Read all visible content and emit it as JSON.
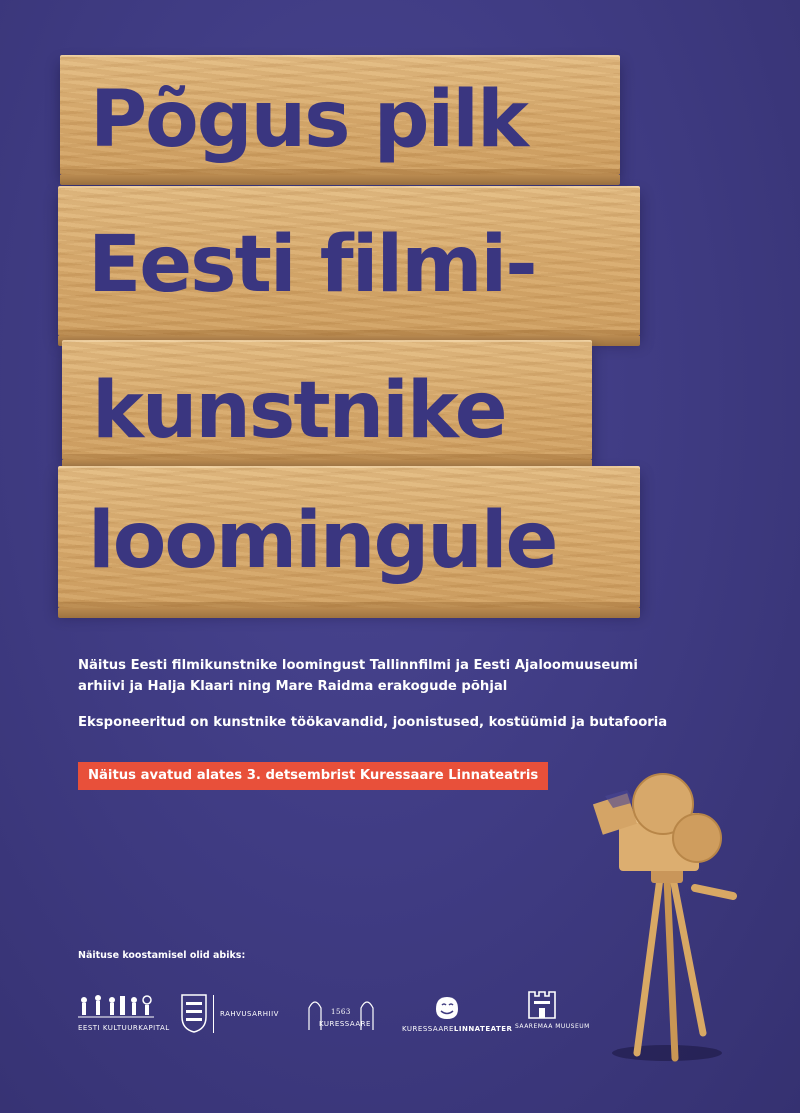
{
  "poster": {
    "title_lines": [
      "Põgus pilk",
      "Eesti filmi-",
      "kunstnike",
      "loomingule"
    ],
    "description_1_line_1": "Näitus Eesti filmikunstnike loomingust Tallinnfilmi ja Eesti Ajaloomuuseumi",
    "description_1_line_2": "arhiivi ja Halja Klaari ning Mare Raidma erakogude põhjal",
    "description_2": "Eksponeeritud on kunstnike töökavandid, joonistused, kostüümid ja butafooria",
    "opening_notice": "Näitus avatud alates 3. detsembrist Kuressaare Linnateatris",
    "helpers_heading": "Näituse koostamisel olid abiks:"
  },
  "logos": [
    {
      "icon": "kulka-figures-icon",
      "label": "EESTI KULTUURKAPITAL"
    },
    {
      "icon": "estonian-coat-of-arms-icon",
      "label": "RAHVUSARHIIV"
    },
    {
      "icon": "kuressaare-arches-icon",
      "label": "KURESSAARE",
      "year": "1563"
    },
    {
      "icon": "theatre-mask-icon",
      "label_part_1": "KURESSAARE",
      "label_part_2": "LINNATEATER"
    },
    {
      "icon": "castle-icon",
      "label": "SAAREMAA MUUSEUM"
    }
  ],
  "colors": {
    "background": "#3f3b80",
    "title_text": "#3a3680",
    "wood": "#d9aa6c",
    "badge": "#e8503a"
  }
}
